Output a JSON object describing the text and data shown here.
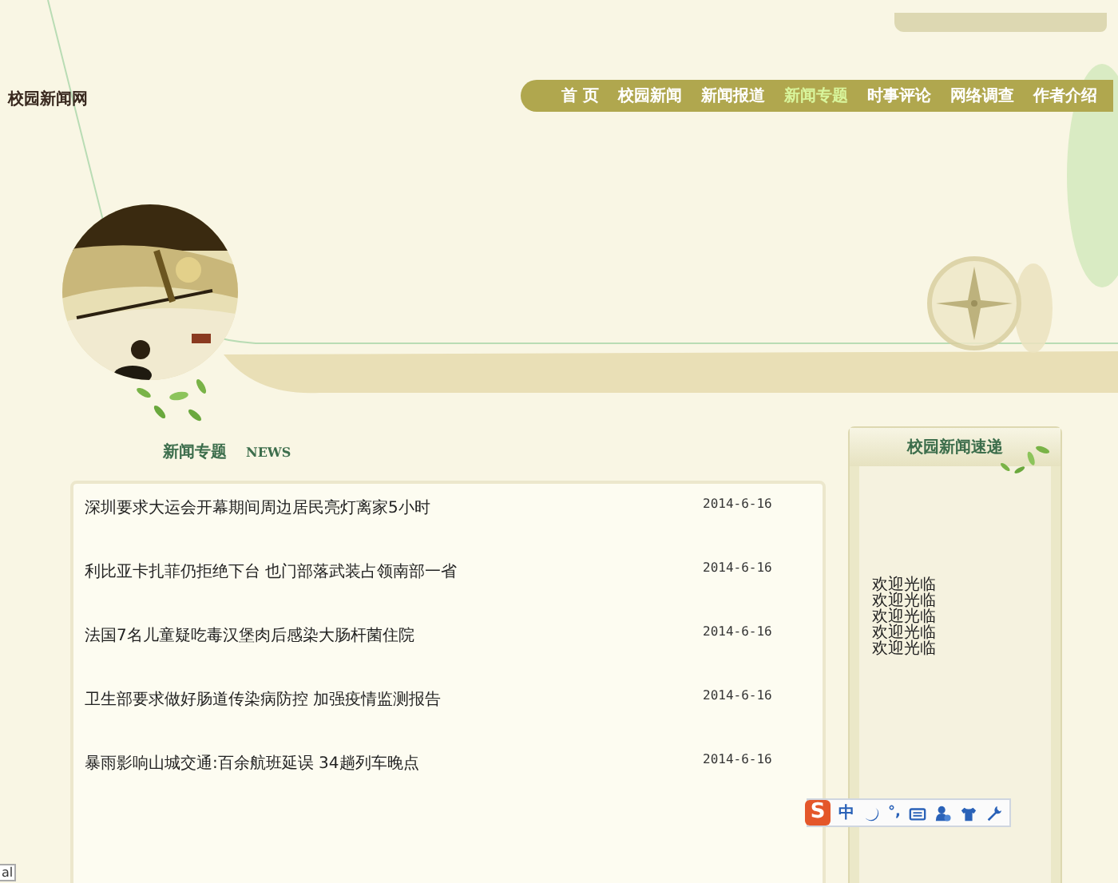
{
  "site_title": "校园新闻网",
  "nav": [
    {
      "label": "首 页",
      "selected": false
    },
    {
      "label": "校园新闻",
      "selected": false
    },
    {
      "label": "新闻报道",
      "selected": false
    },
    {
      "label": "新闻专题",
      "selected": true
    },
    {
      "label": "时事评论",
      "selected": false
    },
    {
      "label": "网络调查",
      "selected": false
    },
    {
      "label": "作者介绍",
      "selected": false
    }
  ],
  "section": {
    "title": "新闻专题",
    "subtitle": "NEWS"
  },
  "news": [
    {
      "title": "深圳要求大运会开幕期间周边居民亮灯离家5小时",
      "date": "2014-6-16"
    },
    {
      "title": "利比亚卡扎菲仍拒绝下台 也门部落武装占领南部一省",
      "date": "2014-6-16"
    },
    {
      "title": "法国7名儿童疑吃毒汉堡肉后感染大肠杆菌住院",
      "date": "2014-6-16"
    },
    {
      "title": "卫生部要求做好肠道传染病防控 加强疫情监测报告",
      "date": "2014-6-16"
    },
    {
      "title": "暴雨影响山城交通:百余航班延误 34趟列车晚点",
      "date": "2014-6-16"
    }
  ],
  "sidebar": {
    "title": "校园新闻速递",
    "lines": [
      "欢迎光临",
      "欢迎光临",
      "欢迎光临",
      "欢迎光临",
      "欢迎光临"
    ]
  },
  "ime_toolbar": {
    "logo": "S",
    "items": [
      {
        "kind": "mode",
        "label": "中"
      },
      {
        "kind": "moon"
      },
      {
        "kind": "punct",
        "label": "°,"
      },
      {
        "kind": "keyboard"
      },
      {
        "kind": "user"
      },
      {
        "kind": "shirt"
      },
      {
        "kind": "wrench"
      }
    ]
  },
  "corner_text": "al"
}
